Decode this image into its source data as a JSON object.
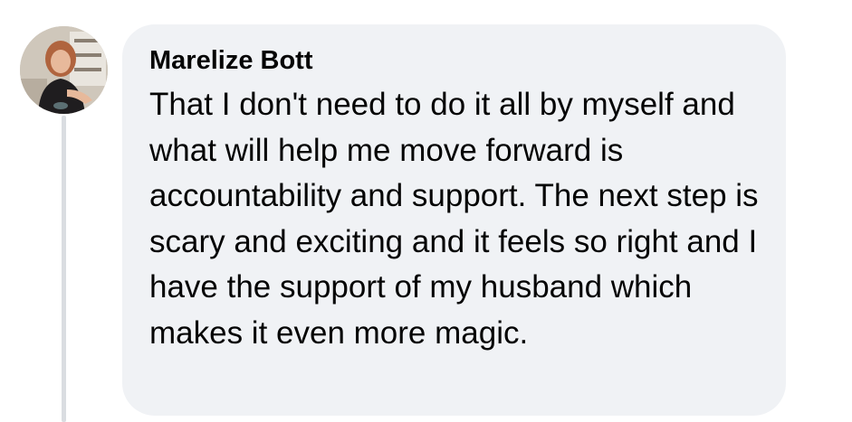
{
  "comment": {
    "author": {
      "name": "Marelize Bott",
      "avatar_icon": "profile-photo"
    },
    "text": "That I don't need to do it all by myself and what will help me move forward is accountability and support. The next step is scary and exciting and it feels so right and I have the support of my husband which makes it even more magic."
  },
  "colors": {
    "bubble_background": "#f0f2f5",
    "text": "#050505",
    "thread_line": "#dadde1"
  }
}
